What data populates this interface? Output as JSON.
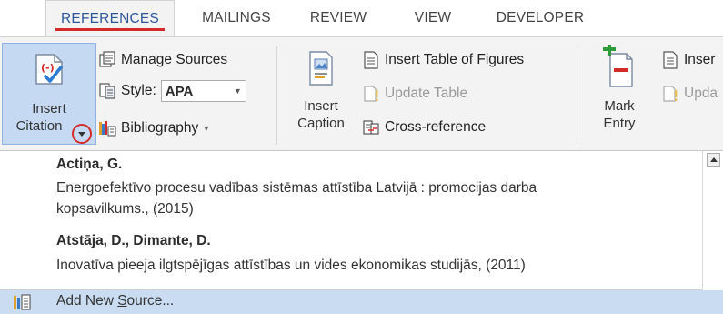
{
  "tabs": [
    {
      "label": "REFERENCES",
      "active": true
    },
    {
      "label": "MAILINGS",
      "active": false
    },
    {
      "label": "REVIEW",
      "active": false
    },
    {
      "label": "VIEW",
      "active": false
    },
    {
      "label": "DEVELOPER",
      "active": false
    }
  ],
  "ribbon": {
    "insert_citation": {
      "line1": "Insert",
      "line2": "Citation",
      "selected": true
    },
    "manage_sources": "Manage Sources",
    "style_label": "Style:",
    "style_value": "APA",
    "bibliography": "Bibliography",
    "insert_caption": {
      "line1": "Insert",
      "line2": "Caption"
    },
    "insert_table_of_figures": "Insert Table of Figures",
    "update_table": "Update Table",
    "cross_reference": "Cross-reference",
    "mark_entry": {
      "line1": "Mark",
      "line2": "Entry"
    },
    "insert_index_partial": "Inser",
    "update_index_partial": "Upda"
  },
  "gallery": {
    "entries": [
      {
        "author": "Actiņa, G.",
        "title_line1": "Energoefektīvo procesu vadības sistēmas attīstība Latvijā : promocijas darba",
        "title_line2": "kopsavilkums., (2015)"
      },
      {
        "author": "Atstāja, D., Dimante, D.",
        "title_line1": "Inovatīva pieeja ilgtspējīgas attīstības un vides ekonomikas studijās, (2011)",
        "title_line2": ""
      }
    ],
    "add_new_source": {
      "before": "Add New ",
      "accel": "S",
      "after": "ource..."
    }
  },
  "colors": {
    "accent_red": "#d52a2a",
    "selected_blue": "#c5daf2",
    "highlight_row": "#c9dcf2",
    "ribbon_bg": "#f3f3f3"
  },
  "icons": {
    "insert_citation": "insert-citation-icon",
    "manage_sources": "manage-sources-icon",
    "style": "style-icon",
    "bibliography": "bibliography-icon",
    "insert_caption": "insert-caption-icon",
    "table_of_figures": "table-of-figures-icon",
    "update_table": "update-table-icon",
    "cross_reference": "cross-reference-icon",
    "mark_entry": "mark-entry-icon",
    "add_new_source": "add-new-source-icon"
  }
}
